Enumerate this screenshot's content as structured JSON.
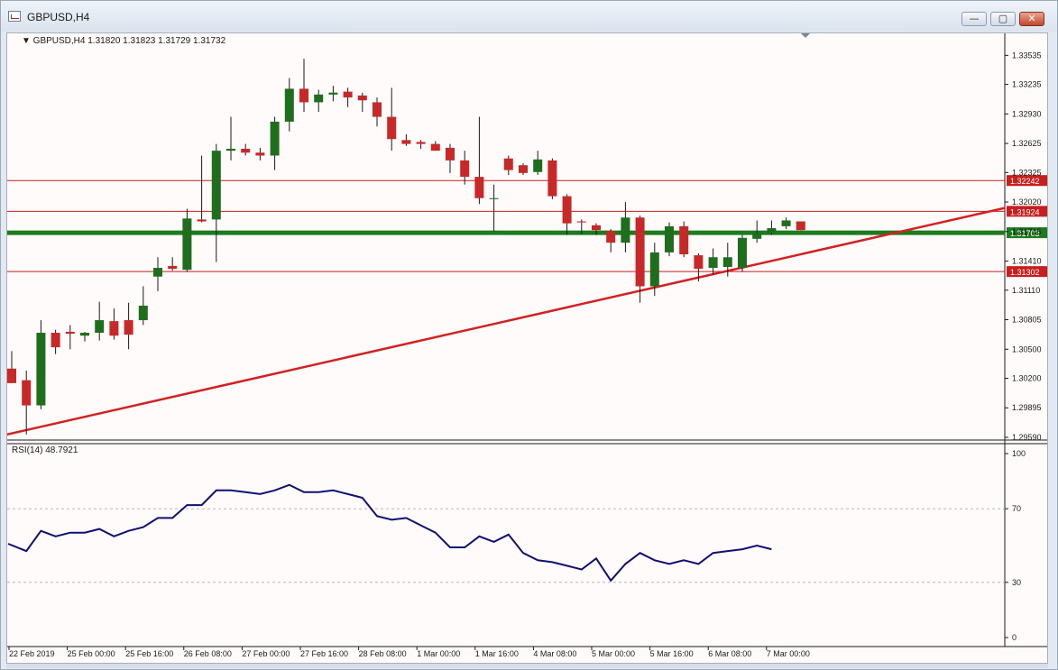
{
  "window": {
    "title": "GBPUSD,H4",
    "buttons": {
      "minimize": "—",
      "maximize": "▢",
      "close": "✕"
    }
  },
  "chart_data": [
    {
      "type": "candlestick",
      "header": "GBPUSD,H4  1.31820 1.31823 1.31729 1.31732",
      "symbol": "GBPUSD,H4",
      "ohlc_readout": "1.31820 1.31823 1.31729 1.31732",
      "y_ticks": [
        "1.33535",
        "1.33235",
        "1.32930",
        "1.32625",
        "1.32325",
        "1.32020",
        "1.31715",
        "1.31410",
        "1.31110",
        "1.30805",
        "1.30500",
        "1.30200",
        "1.29895",
        "1.29590"
      ],
      "ylim": [
        1.2959,
        1.3365
      ],
      "x_labels": [
        "22 Feb 2019",
        "25 Feb 00:00",
        "25 Feb 16:00",
        "26 Feb 08:00",
        "27 Feb 00:00",
        "27 Feb 16:00",
        "28 Feb 08:00",
        "1 Mar 00:00",
        "1 Mar 16:00",
        "4 Mar 08:00",
        "5 Mar 00:00",
        "5 Mar 16:00",
        "6 Mar 08:00",
        "7 Mar 00:00"
      ],
      "candles": [
        {
          "o": 1.303,
          "h": 1.3048,
          "l": 1.3015,
          "c": 1.3015
        },
        {
          "o": 1.3018,
          "h": 1.3028,
          "l": 1.2962,
          "c": 1.2992
        },
        {
          "o": 1.2992,
          "h": 1.308,
          "l": 1.2988,
          "c": 1.3067
        },
        {
          "o": 1.3067,
          "h": 1.307,
          "l": 1.3045,
          "c": 1.3052
        },
        {
          "o": 1.3068,
          "h": 1.3075,
          "l": 1.305,
          "c": 1.3066
        },
        {
          "o": 1.3064,
          "h": 1.3068,
          "l": 1.3058,
          "c": 1.3067
        },
        {
          "o": 1.3067,
          "h": 1.3099,
          "l": 1.3059,
          "c": 1.308
        },
        {
          "o": 1.3079,
          "h": 1.3092,
          "l": 1.306,
          "c": 1.3064
        },
        {
          "o": 1.308,
          "h": 1.3098,
          "l": 1.305,
          "c": 1.3065
        },
        {
          "o": 1.308,
          "h": 1.3115,
          "l": 1.3075,
          "c": 1.3095
        },
        {
          "o": 1.3125,
          "h": 1.3145,
          "l": 1.311,
          "c": 1.3134
        },
        {
          "o": 1.3136,
          "h": 1.3145,
          "l": 1.3131,
          "c": 1.3133
        },
        {
          "o": 1.3132,
          "h": 1.3195,
          "l": 1.313,
          "c": 1.3185
        },
        {
          "o": 1.3184,
          "h": 1.325,
          "l": 1.3181,
          "c": 1.3182
        },
        {
          "o": 1.3184,
          "h": 1.3262,
          "l": 1.314,
          "c": 1.3255
        },
        {
          "o": 1.3255,
          "h": 1.329,
          "l": 1.3245,
          "c": 1.3257
        },
        {
          "o": 1.3257,
          "h": 1.3262,
          "l": 1.325,
          "c": 1.3253
        },
        {
          "o": 1.3253,
          "h": 1.3258,
          "l": 1.3245,
          "c": 1.325
        },
        {
          "o": 1.325,
          "h": 1.329,
          "l": 1.3235,
          "c": 1.3285
        },
        {
          "o": 1.3285,
          "h": 1.333,
          "l": 1.3275,
          "c": 1.3319
        },
        {
          "o": 1.3319,
          "h": 1.335,
          "l": 1.3295,
          "c": 1.3305
        },
        {
          "o": 1.3305,
          "h": 1.3318,
          "l": 1.3295,
          "c": 1.3313
        },
        {
          "o": 1.3313,
          "h": 1.3322,
          "l": 1.3306,
          "c": 1.3315
        },
        {
          "o": 1.3316,
          "h": 1.332,
          "l": 1.33,
          "c": 1.331
        },
        {
          "o": 1.3312,
          "h": 1.3315,
          "l": 1.3295,
          "c": 1.3307
        },
        {
          "o": 1.3305,
          "h": 1.331,
          "l": 1.328,
          "c": 1.329
        },
        {
          "o": 1.329,
          "h": 1.332,
          "l": 1.3255,
          "c": 1.3267
        },
        {
          "o": 1.3266,
          "h": 1.3272,
          "l": 1.326,
          "c": 1.3262
        },
        {
          "o": 1.3264,
          "h": 1.3266,
          "l": 1.3257,
          "c": 1.3262
        },
        {
          "o": 1.3262,
          "h": 1.3265,
          "l": 1.3255,
          "c": 1.3255
        },
        {
          "o": 1.3258,
          "h": 1.3262,
          "l": 1.3232,
          "c": 1.3245
        },
        {
          "o": 1.3245,
          "h": 1.3255,
          "l": 1.322,
          "c": 1.3228
        },
        {
          "o": 1.3228,
          "h": 1.329,
          "l": 1.32,
          "c": 1.3206
        },
        {
          "o": 1.3205,
          "h": 1.322,
          "l": 1.3172,
          "c": 1.3206
        },
        {
          "o": 1.3247,
          "h": 1.325,
          "l": 1.323,
          "c": 1.3235
        },
        {
          "o": 1.324,
          "h": 1.3242,
          "l": 1.323,
          "c": 1.3232
        },
        {
          "o": 1.3233,
          "h": 1.3255,
          "l": 1.323,
          "c": 1.3246
        },
        {
          "o": 1.3245,
          "h": 1.3247,
          "l": 1.3205,
          "c": 1.3208
        },
        {
          "o": 1.3208,
          "h": 1.321,
          "l": 1.3168,
          "c": 1.318
        },
        {
          "o": 1.3182,
          "h": 1.3184,
          "l": 1.3169,
          "c": 1.3181
        },
        {
          "o": 1.3178,
          "h": 1.318,
          "l": 1.3168,
          "c": 1.3173
        },
        {
          "o": 1.3172,
          "h": 1.3174,
          "l": 1.315,
          "c": 1.316
        },
        {
          "o": 1.316,
          "h": 1.3202,
          "l": 1.315,
          "c": 1.3186
        },
        {
          "o": 1.3186,
          "h": 1.3188,
          "l": 1.3098,
          "c": 1.3115
        },
        {
          "o": 1.3115,
          "h": 1.316,
          "l": 1.3105,
          "c": 1.315
        },
        {
          "o": 1.315,
          "h": 1.3181,
          "l": 1.3146,
          "c": 1.3177
        },
        {
          "o": 1.3177,
          "h": 1.3182,
          "l": 1.3145,
          "c": 1.3148
        },
        {
          "o": 1.3147,
          "h": 1.3149,
          "l": 1.312,
          "c": 1.3133
        },
        {
          "o": 1.3134,
          "h": 1.3154,
          "l": 1.3127,
          "c": 1.3145
        },
        {
          "o": 1.3135,
          "h": 1.316,
          "l": 1.3125,
          "c": 1.3145
        },
        {
          "o": 1.3134,
          "h": 1.3168,
          "l": 1.313,
          "c": 1.3165
        },
        {
          "o": 1.3164,
          "h": 1.3183,
          "l": 1.316,
          "c": 1.317
        },
        {
          "o": 1.317,
          "h": 1.3183,
          "l": 1.3168,
          "c": 1.3175
        },
        {
          "o": 1.3177,
          "h": 1.3186,
          "l": 1.3174,
          "c": 1.3183
        },
        {
          "o": 1.3182,
          "h": 1.3182,
          "l": 1.3173,
          "c": 1.3173
        }
      ],
      "horizontal_levels": [
        {
          "value": 1.32242,
          "label": "1.32242",
          "color": "#c81e1e"
        },
        {
          "value": 1.31924,
          "label": "1.31924",
          "color": "#c81e1e"
        },
        {
          "value": 1.31703,
          "label": "1.31703",
          "color": "#1e7a1e"
        },
        {
          "value": 1.31302,
          "label": "1.31302",
          "color": "#c81e1e"
        }
      ],
      "trendline": {
        "color": "#d42020",
        "from": {
          "bar": -0.6,
          "price": 1.2961
        },
        "to": {
          "bar": 68,
          "price": 1.3196
        }
      },
      "colors": {
        "bull": "#1e6e1e",
        "bear": "#c82828",
        "wick": "#1a1a1a",
        "grid": "#c0c0c0"
      }
    },
    {
      "type": "line",
      "label": "RSI(14) 48.7921",
      "ylim": [
        0,
        100
      ],
      "y_ticks": [
        "100",
        "70",
        "30",
        "0"
      ],
      "levels": [
        70,
        30
      ],
      "values": [
        51,
        47,
        58,
        55,
        57,
        57,
        59,
        55,
        58,
        60,
        65,
        65,
        72,
        72,
        80,
        80,
        79,
        78,
        80,
        83,
        79,
        79,
        80,
        78,
        76,
        66,
        64,
        65,
        61,
        57,
        49,
        49,
        55,
        52,
        56,
        46,
        42,
        41,
        39,
        37,
        43,
        31,
        40,
        46,
        42,
        40,
        42,
        40,
        46,
        47,
        48,
        50,
        48
      ],
      "color": "#101073"
    }
  ]
}
